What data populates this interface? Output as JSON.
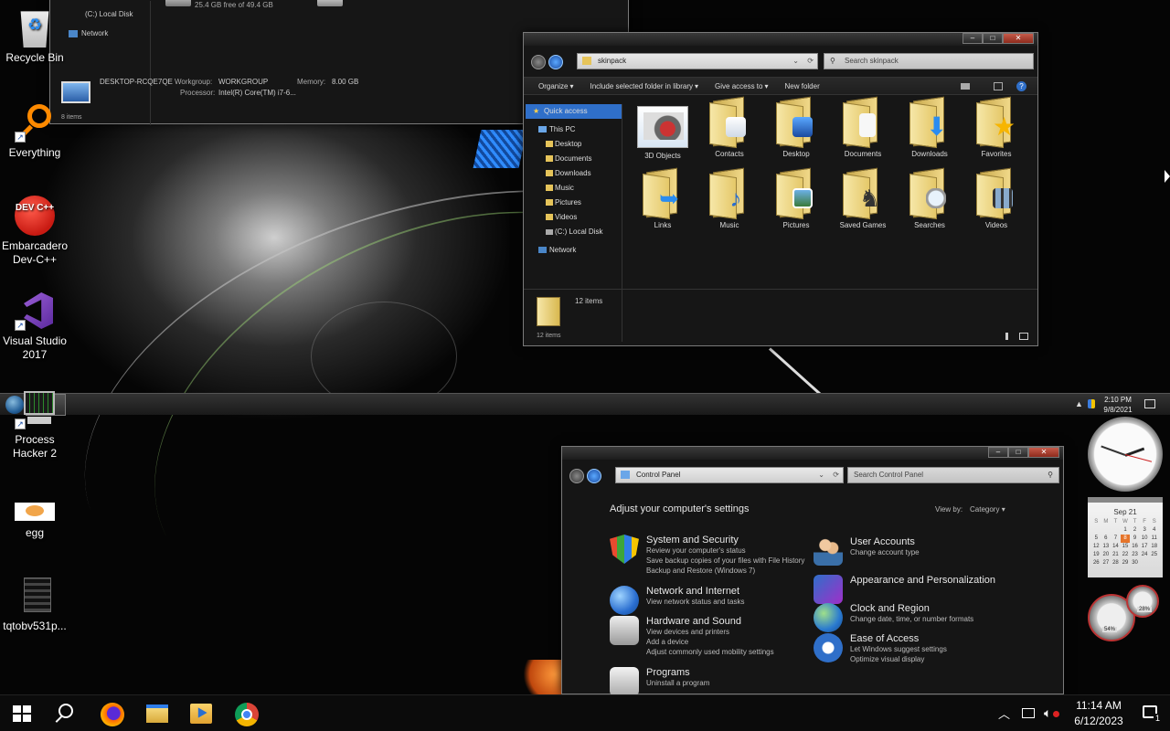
{
  "desktop_icons": [
    {
      "label": "Recycle Bin",
      "icon": "recycle-bin-icon"
    },
    {
      "label": "Everything",
      "icon": "everything-search-icon"
    },
    {
      "label": "Embarcadero Dev-C++",
      "icon": "devcpp-icon",
      "badge_text": "DEV C++"
    },
    {
      "label": "Visual Studio 2017",
      "icon": "visual-studio-icon"
    },
    {
      "label": "Process Hacker 2",
      "icon": "process-hacker-icon"
    },
    {
      "label": "egg",
      "icon": "egg-image-icon"
    },
    {
      "label": "tqtobv531p...",
      "icon": "image-file-icon"
    }
  ],
  "bg_window": {
    "nav_local_disk": "(C:) Local Disk",
    "nav_network": "Network",
    "disk_free": "25.4 GB free of 49.4 GB",
    "computer_name": "DESKTOP-RCQE7QE",
    "workgroup_label": "Workgroup:",
    "workgroup_value": "WORKGROUP",
    "memory_label": "Memory:",
    "memory_value": "8.00 GB",
    "processor_label": "Processor:",
    "processor_value": "Intel(R) Core(TM) i7-6...",
    "items_count": "8 items"
  },
  "explorer": {
    "address": "skinpack",
    "search_placeholder": "Search skinpack",
    "toolbar": [
      "Organize",
      "Include selected folder in library",
      "Give access to",
      "New folder"
    ],
    "nav": {
      "quick_access": "Quick access",
      "this_pc": "This PC",
      "items": [
        "Desktop",
        "Documents",
        "Downloads",
        "Music",
        "Pictures",
        "Videos",
        "(C:) Local Disk"
      ],
      "network": "Network"
    },
    "folders": [
      "3D Objects",
      "Contacts",
      "Desktop",
      "Documents",
      "Downloads",
      "Favorites",
      "Links",
      "Music",
      "Pictures",
      "Saved Games",
      "Searches",
      "Videos"
    ],
    "details_count": "12 items",
    "status": "12 items"
  },
  "upper_taskbar": {
    "time": "2:10 PM",
    "date": "9/8/2021"
  },
  "control_panel": {
    "address": "Control Panel",
    "search_placeholder": "Search Control Panel",
    "heading": "Adjust your computer's settings",
    "view_by_label": "View by:",
    "view_by_value": "Category",
    "left": [
      {
        "title": "System and Security",
        "subs": [
          "Review your computer's status",
          "Save backup copies of your files with File History",
          "Backup and Restore (Windows 7)"
        ]
      },
      {
        "title": "Network and Internet",
        "subs": [
          "View network status and tasks"
        ]
      },
      {
        "title": "Hardware and Sound",
        "subs": [
          "View devices and printers",
          "Add a device",
          "Adjust commonly used mobility settings"
        ]
      },
      {
        "title": "Programs",
        "subs": [
          "Uninstall a program"
        ]
      }
    ],
    "right": [
      {
        "title": "User Accounts",
        "subs": [
          "Change account type"
        ]
      },
      {
        "title": "Appearance and Personalization",
        "subs": []
      },
      {
        "title": "Clock and Region",
        "subs": [
          "Change date, time, or number formats"
        ]
      },
      {
        "title": "Ease of Access",
        "subs": [
          "Let Windows suggest settings",
          "Optimize visual display"
        ]
      }
    ]
  },
  "gadgets": {
    "calendar_month": "Sep 21",
    "calendar_days_header": [
      "S",
      "M",
      "T",
      "W",
      "T",
      "F",
      "S"
    ],
    "calendar_weeks": [
      [
        "",
        "",
        "",
        "1",
        "2",
        "3",
        "4"
      ],
      [
        "5",
        "6",
        "7",
        "8",
        "9",
        "10",
        "11"
      ],
      [
        "12",
        "13",
        "14",
        "15",
        "16",
        "17",
        "18"
      ],
      [
        "19",
        "20",
        "21",
        "22",
        "23",
        "24",
        "25"
      ],
      [
        "26",
        "27",
        "28",
        "29",
        "30",
        "",
        ""
      ]
    ],
    "calendar_today": "8",
    "cpu_meter": "54%",
    "ram_meter": "28%"
  },
  "taskbar": {
    "time": "11:14 AM",
    "date": "6/12/2023",
    "notification_count": "1"
  },
  "colors": {
    "accent_blue": "#2f6fc9",
    "folder_yellow": "#f1d98a",
    "close_red": "#b8452f"
  }
}
